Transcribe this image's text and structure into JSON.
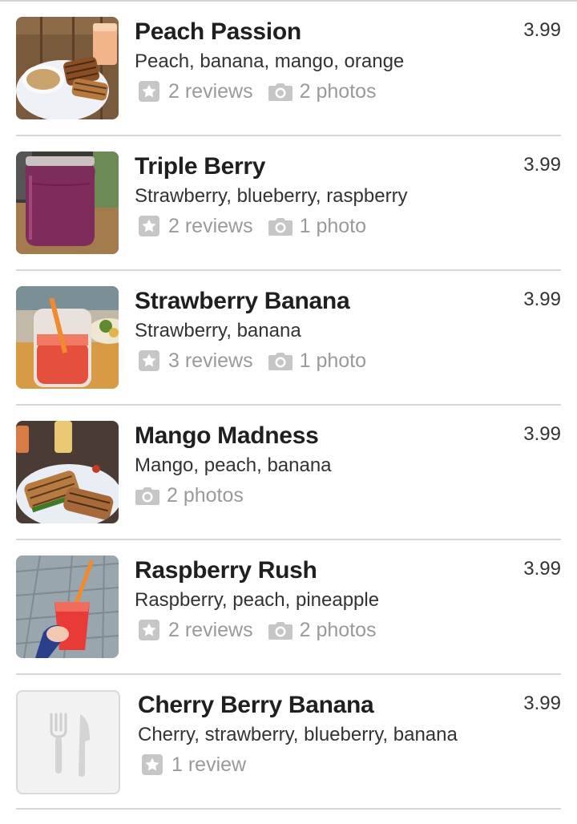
{
  "items": [
    {
      "name": "Peach Passion",
      "desc": "Peach, banana, mango, orange",
      "price": "3.99",
      "reviews": "2 reviews",
      "photos": "2 photos",
      "image": "sandwich-and-soup-photo"
    },
    {
      "name": "Triple Berry",
      "desc": "Strawberry, blueberry, raspberry",
      "price": "3.99",
      "reviews": "2 reviews",
      "photos": "1 photo",
      "image": "purple-smoothie-jar-photo"
    },
    {
      "name": "Strawberry Banana",
      "desc": "Strawberry, banana",
      "price": "3.99",
      "reviews": "3 reviews",
      "photos": "1 photo",
      "image": "red-smoothie-jar-photo"
    },
    {
      "name": "Mango Madness",
      "desc": "Mango, peach, banana",
      "price": "3.99",
      "photos": "2 photos",
      "image": "panini-plate-photo"
    },
    {
      "name": "Raspberry Rush",
      "desc": "Raspberry, peach, pineapple",
      "price": "3.99",
      "reviews": "2 reviews",
      "photos": "2 photos",
      "image": "hand-holding-cup-photo"
    },
    {
      "name": "Cherry Berry Banana",
      "desc": "Cherry, strawberry, blueberry, banana",
      "price": "3.99",
      "reviews": "1 review",
      "image": "fork-knife-placeholder-icon"
    }
  ],
  "icons": {
    "review": "star-icon",
    "photo": "camera-icon"
  },
  "colors": {
    "title": "#1f1f1f",
    "meta": "#9a9a9a",
    "divider": "#d6d6d6"
  }
}
